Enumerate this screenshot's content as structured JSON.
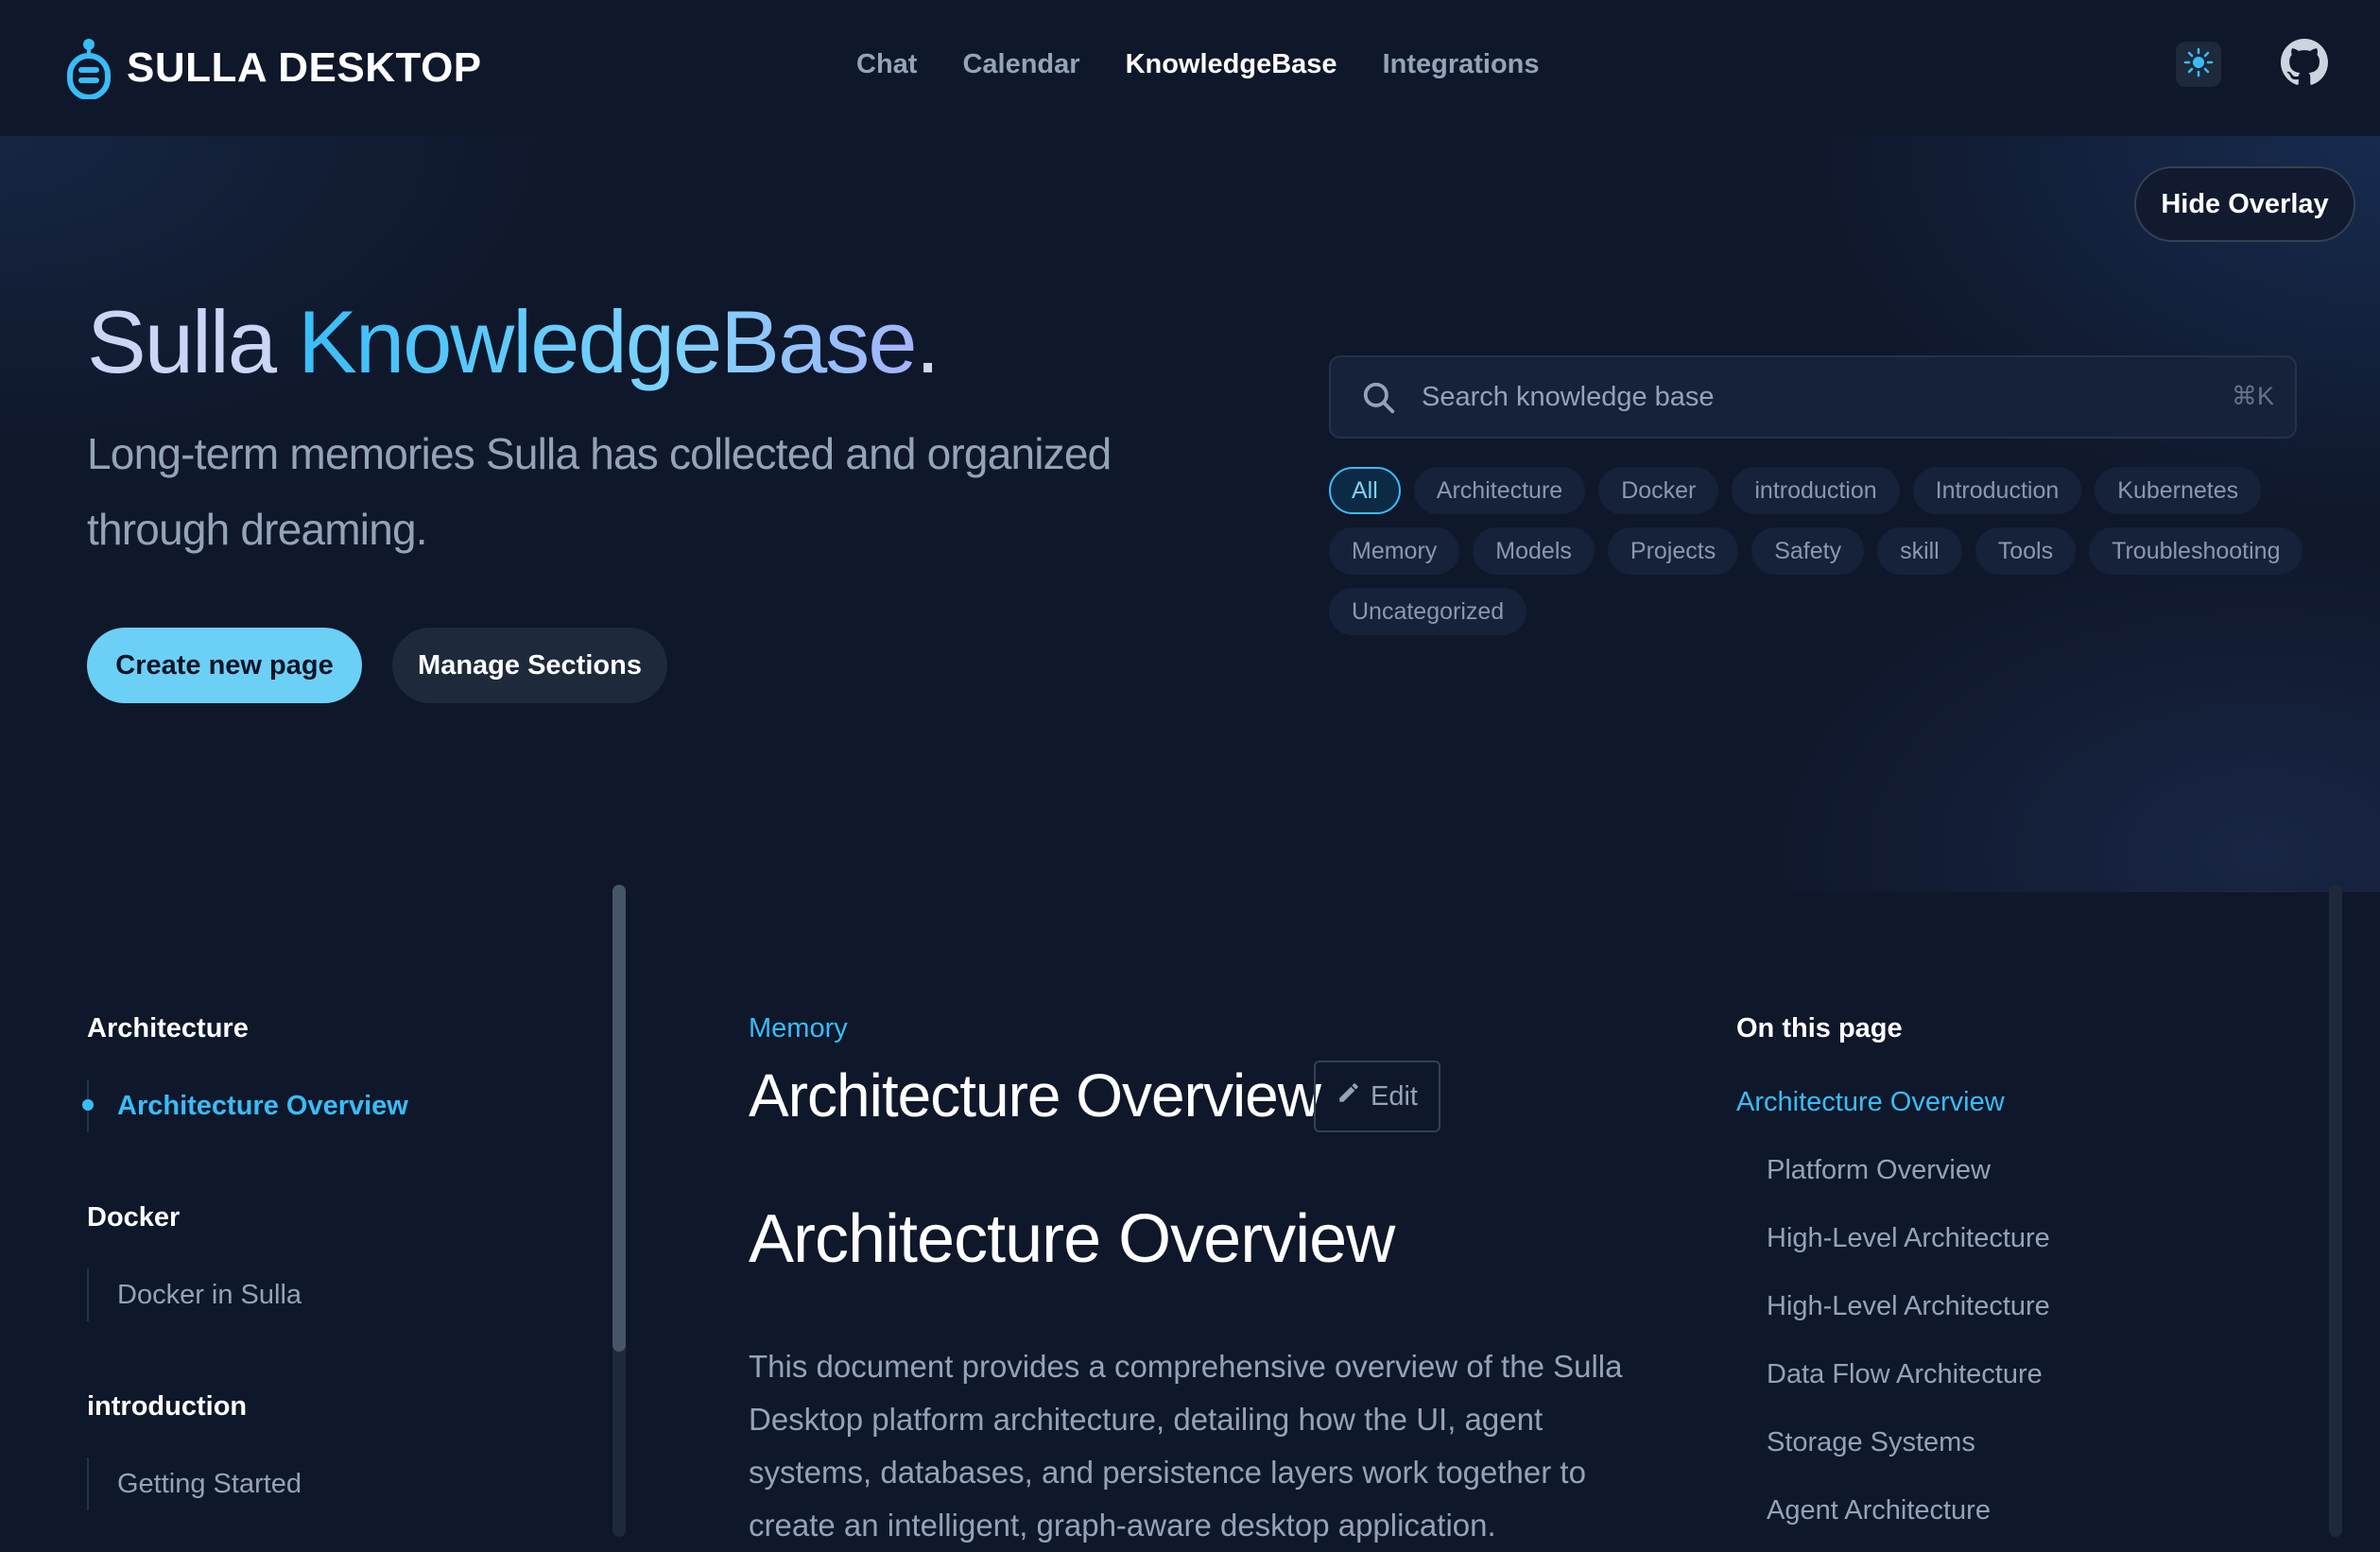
{
  "brand": {
    "name": "SULLA DESKTOP",
    "logo_icon": "robot-logo-icon",
    "accent": "#38bdf8"
  },
  "nav": {
    "links": [
      {
        "label": "Chat",
        "active": false
      },
      {
        "label": "Calendar",
        "active": false
      },
      {
        "label": "KnowledgeBase",
        "active": true
      },
      {
        "label": "Integrations",
        "active": false
      }
    ],
    "theme_icon": "sun-icon",
    "github_icon": "github-icon"
  },
  "overlay": {
    "hide_label": "Hide Overlay"
  },
  "hero": {
    "title_part1": "Sulla ",
    "title_part2": "KnowledgeBase",
    "title_part3": ".",
    "subtitle": "Long-term memories Sulla has collected and organized through dreaming.",
    "primary_button": "Create new page",
    "secondary_button": "Manage Sections"
  },
  "search": {
    "placeholder": "Search knowledge base",
    "shortcut": "⌘K",
    "icon": "search-icon"
  },
  "tags": [
    {
      "label": "All",
      "active": true
    },
    {
      "label": "Architecture",
      "active": false
    },
    {
      "label": "Docker",
      "active": false
    },
    {
      "label": "introduction",
      "active": false
    },
    {
      "label": "Introduction",
      "active": false
    },
    {
      "label": "Kubernetes",
      "active": false
    },
    {
      "label": "Memory",
      "active": false
    },
    {
      "label": "Models",
      "active": false
    },
    {
      "label": "Projects",
      "active": false
    },
    {
      "label": "Safety",
      "active": false
    },
    {
      "label": "skill",
      "active": false
    },
    {
      "label": "Tools",
      "active": false
    },
    {
      "label": "Troubleshooting",
      "active": false
    },
    {
      "label": "Uncategorized",
      "active": false
    }
  ],
  "sidebar": {
    "groups": [
      {
        "heading": "Architecture",
        "items": [
          {
            "label": "Architecture Overview",
            "active": true
          }
        ]
      },
      {
        "heading": "Docker",
        "items": [
          {
            "label": "Docker in Sulla",
            "active": false
          }
        ]
      },
      {
        "heading": "introduction",
        "items": [
          {
            "label": "Getting Started",
            "active": false
          }
        ]
      }
    ]
  },
  "main": {
    "category": "Memory",
    "title": "Architecture Overview",
    "edit_label": "Edit",
    "edit_icon": "pencil-icon",
    "article_heading": "Architecture Overview",
    "article_paragraph": "This document provides a comprehensive overview of the Sulla Desktop platform architecture, detailing how the UI, agent systems, databases, and persistence layers work together to create an intelligent, graph-aware desktop application."
  },
  "toc": {
    "title": "On this page",
    "items": [
      {
        "label": "Architecture Overview",
        "active": true,
        "level": 1
      },
      {
        "label": "Platform Overview",
        "active": false,
        "level": 2
      },
      {
        "label": "High-Level Architecture",
        "active": false,
        "level": 2
      },
      {
        "label": "High-Level Architecture",
        "active": false,
        "level": 2
      },
      {
        "label": "Data Flow Architecture",
        "active": false,
        "level": 2
      },
      {
        "label": "Storage Systems",
        "active": false,
        "level": 2
      },
      {
        "label": "Agent Architecture",
        "active": false,
        "level": 2
      }
    ]
  }
}
